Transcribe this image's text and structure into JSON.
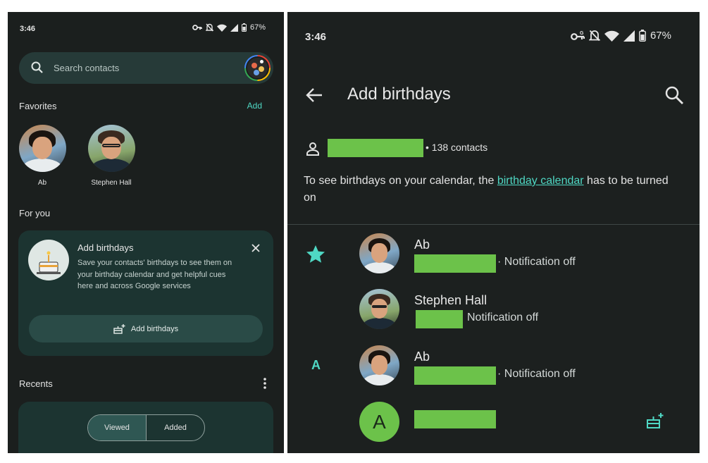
{
  "left": {
    "status": {
      "time": "3:46",
      "battery": "67%"
    },
    "search": {
      "placeholder": "Search contacts"
    },
    "favorites": {
      "title": "Favorites",
      "add_label": "Add",
      "people": [
        {
          "name": "Ab"
        },
        {
          "name": "Stephen Hall"
        }
      ]
    },
    "for_you": {
      "title": "For you",
      "card_title": "Add birthdays",
      "card_body": "Save your contacts' birthdays to see them on your birthday calendar and get helpful cues here and across Google services",
      "button_label": "Add birthdays"
    },
    "recents": {
      "title": "Recents",
      "segments": [
        "Viewed",
        "Added"
      ],
      "selected": "Viewed"
    }
  },
  "right": {
    "status": {
      "time": "3:46",
      "battery": "67%"
    },
    "title": "Add birthdays",
    "account_count": "• 138 contacts",
    "info_before": "To see birthdays on your calendar, the ",
    "info_link": "birthday calendar",
    "info_after": " has to be turned on",
    "contacts": [
      {
        "section": "star",
        "name": "Ab",
        "status": "· Notification off"
      },
      {
        "section": "",
        "name": "Stephen Hall",
        "status": "Notification off"
      },
      {
        "section": "A",
        "name": "Ab",
        "status": "· Notification off"
      },
      {
        "section": "",
        "avatar_letter": "A",
        "name": ""
      }
    ]
  },
  "colors": {
    "accent": "#4fd8c4",
    "redaction": "#6cc24a",
    "background": "#1b1f1e"
  },
  "icons": [
    "search-icon",
    "close-icon",
    "cake-add-icon",
    "more-vert-icon",
    "back-arrow-icon",
    "star-icon",
    "person-icon",
    "wifi-icon",
    "signal-icon",
    "battery-icon",
    "key-icon",
    "bell-off-icon"
  ]
}
